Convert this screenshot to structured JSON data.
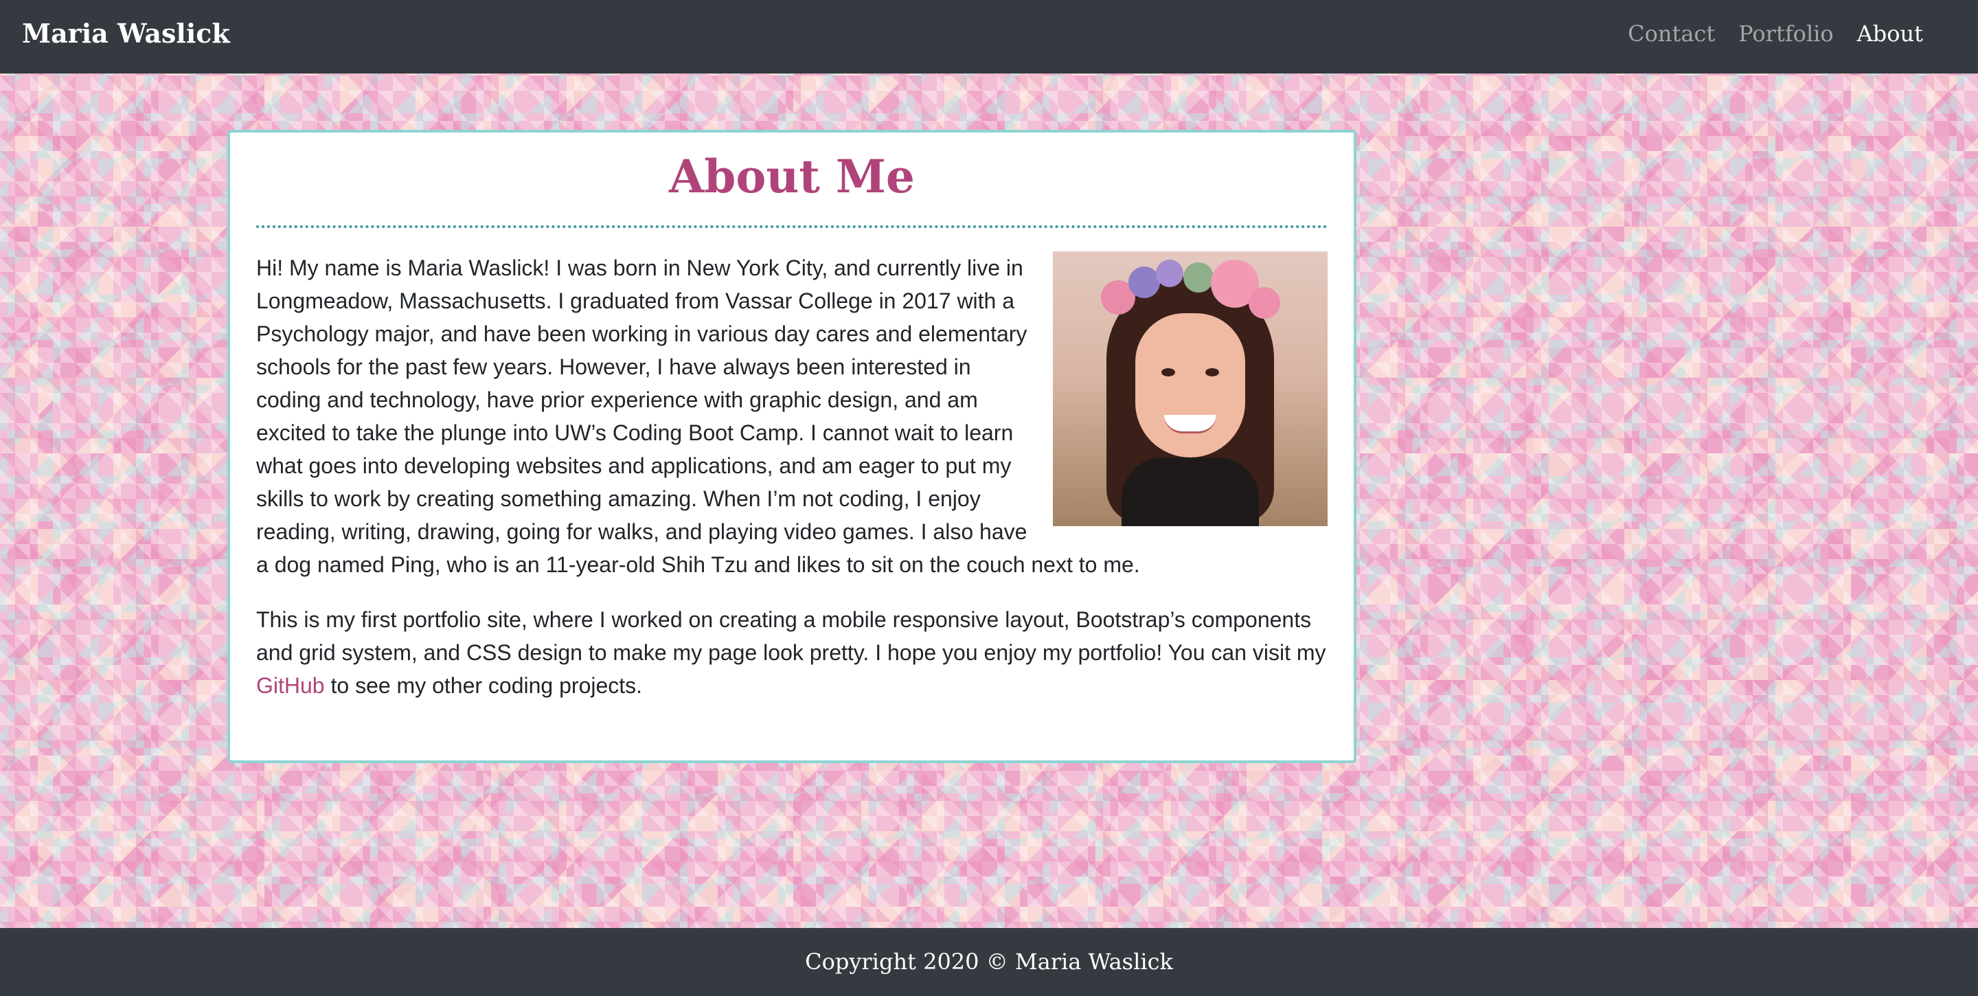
{
  "navbar": {
    "brand": "Maria Waslick",
    "links": [
      {
        "label": "Contact",
        "active": false
      },
      {
        "label": "Portfolio",
        "active": false
      },
      {
        "label": "About",
        "active": true
      }
    ]
  },
  "about": {
    "title": "About Me",
    "paragraph1": "Hi! My name is Maria Waslick! I was born in New York City, and currently live in Longmeadow, Massachusetts. I graduated from Vassar College in 2017 with a Psychology major, and have been working in various day cares and elementary schools for the past few years. However, I have always been interested in coding and technology, have prior experience with graphic design, and am excited to take the plunge into UW’s Coding Boot Camp. I cannot wait to learn what goes into developing websites and applications, and am eager to put my skills to work by creating something amazing. When I’m not coding, I enjoy reading, writing, drawing, going for walks, and playing video games. I also have a dog named Ping, who is an 11-year-old Shih Tzu and likes to sit on the couch next to me.",
    "paragraph2_start": "This is my first portfolio site, where I worked on creating a mobile responsive layout, Bootstrap’s components and grid system, and CSS design to make my page look pretty. I hope you enjoy my portfolio! You can visit my",
    "github_link": "GitHub",
    "paragraph2_end": "to see my other coding projects."
  },
  "footer": {
    "copyright": "Copyright 2020 © Maria Waslick"
  },
  "colors": {
    "navbar_bg": "#343a40",
    "accent_pink": "#b0447a",
    "card_border": "#8fd3d3",
    "divider": "#3b95a3"
  }
}
